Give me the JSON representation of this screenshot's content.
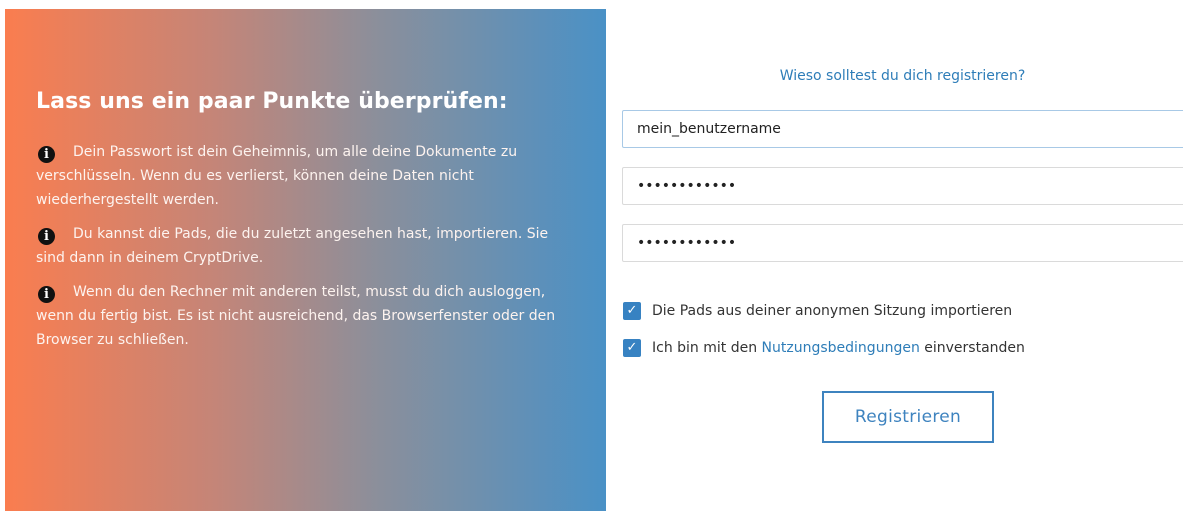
{
  "info": {
    "title": "Lass uns ein paar Punkte überprüfen:",
    "items": [
      {
        "icon": "info-circle-icon",
        "text": "Dein Passwort ist dein Geheimnis, um alle deine Dokumente zu verschlüsseln. Wenn du es verlierst, können deine Daten nicht wiederhergestellt werden."
      },
      {
        "icon": "info-circle-icon",
        "text": "Du kannst die Pads, die du zuletzt angesehen hast, importieren. Sie sind dann in deinem CryptDrive."
      },
      {
        "icon": "info-circle-icon",
        "text": "Wenn du den Rechner mit anderen teilst, musst du dich ausloggen, wenn du fertig bist. Es ist nicht ausreichend, das Browserfenster oder den Browser zu schließen."
      }
    ],
    "gradient": {
      "from": "#fa7d4f",
      "to": "#4a91c6"
    }
  },
  "form": {
    "why_link": "Wieso solltest du dich registrieren?",
    "username_value": "mein_benutzername",
    "password_value": "••••••••••••",
    "password_confirm_value": "••••••••••••",
    "import_pads_label": "Die Pads aus deiner anonymen Sitzung importieren",
    "import_pads_checked": true,
    "terms_prefix": "Ich bin mit den ",
    "terms_link": "Nutzungsbedingungen",
    "terms_suffix": " einverstanden",
    "terms_checked": true,
    "register_label": "Registrieren",
    "accent_color": "#3e83bf"
  }
}
